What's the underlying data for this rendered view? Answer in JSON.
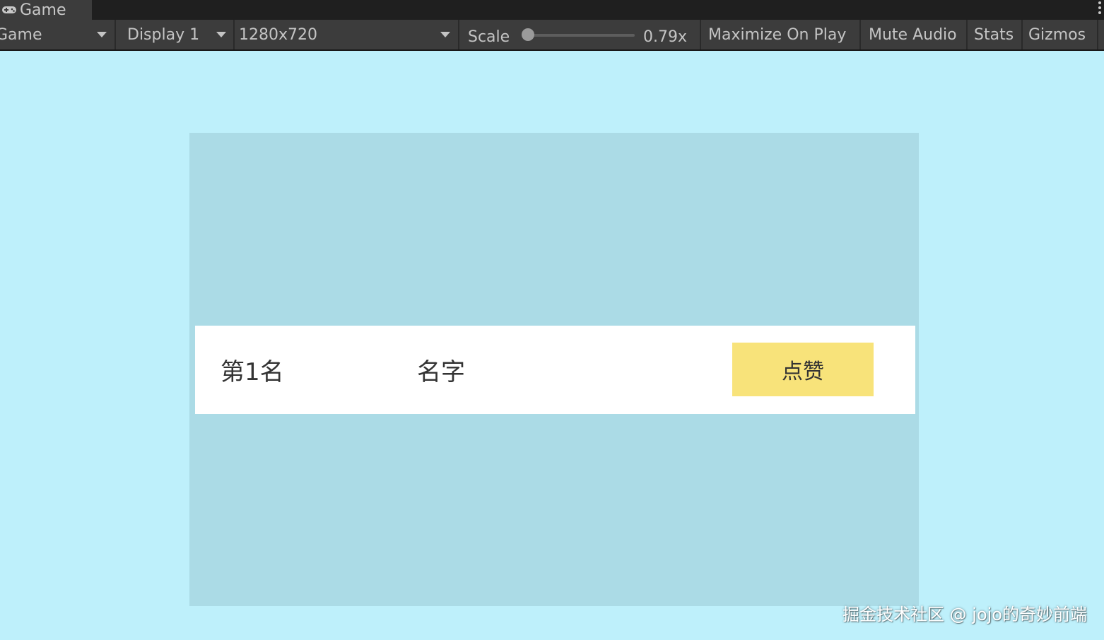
{
  "window": {
    "tab_label": "Game",
    "tab_icon": "gamepad-icon"
  },
  "toolbar": {
    "view_mode": "Game",
    "display": "Display 1",
    "resolution": "1280x720",
    "scale_label": "Scale",
    "scale_value": "0.79x",
    "maximize_on_play": "Maximize On Play",
    "mute_audio": "Mute Audio",
    "stats": "Stats",
    "gizmos": "Gizmos"
  },
  "game": {
    "row": {
      "rank": "第1名",
      "name": "名字",
      "like_button": "点赞"
    }
  },
  "watermark": "掘金技术社区 @ jojo的奇妙前端",
  "colors": {
    "editor_background": "#bef0fb",
    "panel_background": "#abdbe6",
    "row_background": "#ffffff",
    "like_button": "#f8e37a",
    "toolbar": "#3c3c3c"
  }
}
